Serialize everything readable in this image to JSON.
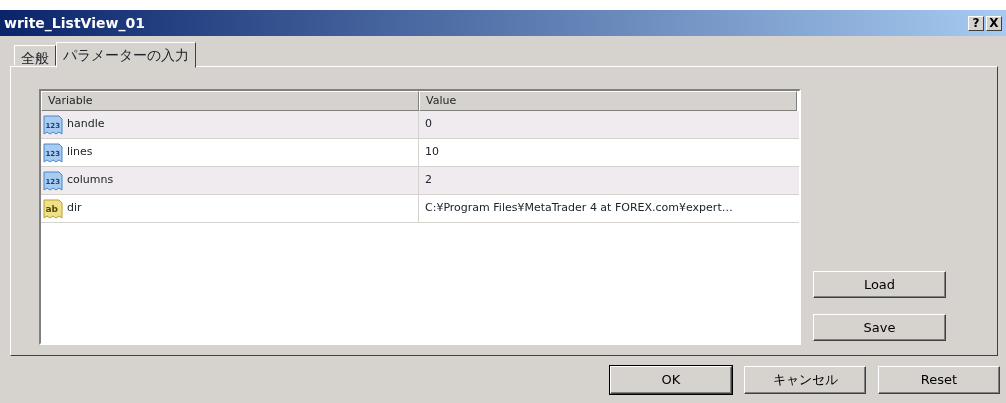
{
  "window": {
    "title": "write_ListView_01"
  },
  "title_buttons": [
    "?",
    "X"
  ],
  "tabs": [
    {
      "label": "全般",
      "selected": false
    },
    {
      "label": "パラメーターの入力",
      "selected": true
    }
  ],
  "table": {
    "columns": [
      "Variable",
      "Value"
    ],
    "rows": [
      {
        "kind": "int",
        "icon_text": "123",
        "variable": "handle",
        "value": "0"
      },
      {
        "kind": "int",
        "icon_text": "123",
        "variable": "lines",
        "value": "10"
      },
      {
        "kind": "int",
        "icon_text": "123",
        "variable": "columns",
        "value": "2"
      },
      {
        "kind": "string",
        "icon_text": "ab",
        "variable": "dir",
        "value": "C:¥Program Files¥MetaTrader 4 at FOREX.com¥expert…"
      }
    ]
  },
  "side_buttons": [
    "Load",
    "Save"
  ],
  "buttons": [
    {
      "label": "OK",
      "default": true
    },
    {
      "label": "キャンセル",
      "default": false
    },
    {
      "label": "Reset",
      "default": false
    }
  ]
}
